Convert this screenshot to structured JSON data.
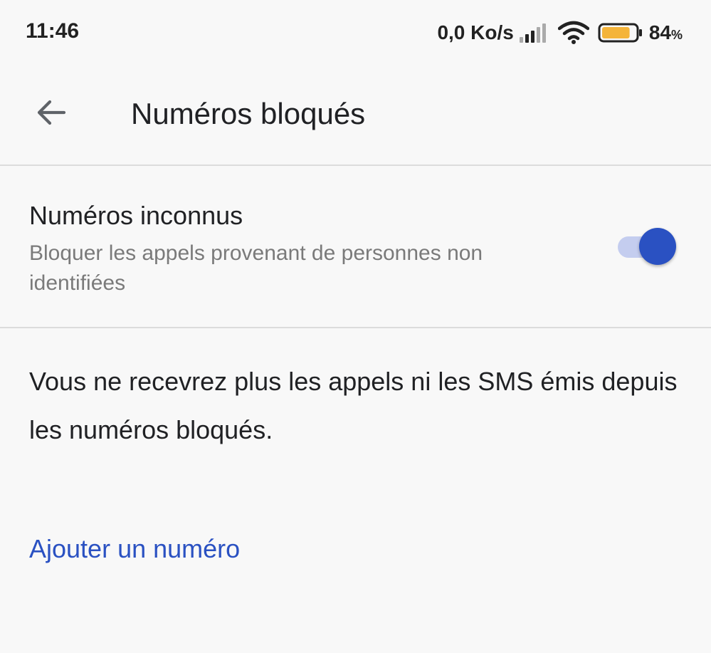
{
  "status_bar": {
    "time": "11:46",
    "net_speed": "0,0 Ko/s",
    "battery_level": "84",
    "battery_unit": "%",
    "battery_fill_fraction": 0.84,
    "battery_color": "#f4b43a",
    "icons": [
      "signal-icon",
      "wifi-icon",
      "battery-icon"
    ]
  },
  "app_bar": {
    "back_icon": "arrow-left-icon",
    "title": "Numéros bloqués"
  },
  "unknown_numbers": {
    "title": "Numéros inconnus",
    "summary": "Bloquer les appels provenant de personnes non identifiées",
    "enabled": true
  },
  "info": {
    "text": "Vous ne recevrez plus les appels ni les SMS émis depuis les numéros bloqués."
  },
  "actions": {
    "add_number": "Ajouter un numéro"
  },
  "colors": {
    "accent": "#2a51c2",
    "toggle_track": "#c4cdef",
    "background": "#f8f8f8"
  }
}
